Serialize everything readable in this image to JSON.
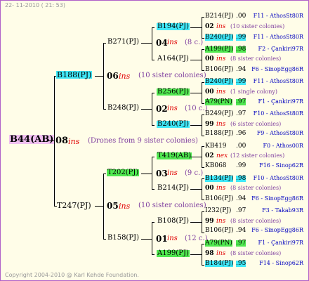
{
  "header_date": "22- 11-2010 ( 21: 53)",
  "footer": "Copyright 2004-2010 @ Karl Kehde Foundation.",
  "root": {
    "label": "B44(AB)"
  },
  "gen1": {
    "num": "08",
    "ins": "ins",
    "note": "(Drones from 9 sister colonies)"
  },
  "g1_top": {
    "label": "B188(PJ)",
    "num": "06",
    "ins": "ins",
    "note": "(10 sister colonies)"
  },
  "g1_bottom": {
    "label": "T247(PJ)",
    "num": "05",
    "ins": "ins",
    "note": "(10 sister colonies)"
  },
  "g2": [
    {
      "label": "B271(PJ)",
      "num": "04",
      "ins": "ins",
      "note": "(8 c.)"
    },
    {
      "label": "B248(PJ)",
      "num": "02",
      "ins": "ins",
      "note": "(10 c.)"
    },
    {
      "label": "T202(PJ)",
      "num": "03",
      "ins": "ins",
      "note": "(9 c.)"
    },
    {
      "label": "B158(PJ)",
      "num": "01",
      "ins": "ins",
      "note": "(12 c.)"
    }
  ],
  "g3": [
    {
      "label": "B194(PJ)"
    },
    {
      "label": "A164(PJ)"
    },
    {
      "label": "B256(PJ)"
    },
    {
      "label": "B240(PJ)"
    },
    {
      "label": "T419(AB)"
    },
    {
      "label": "B214(PJ)"
    },
    {
      "label": "B108(PJ)"
    },
    {
      "label": "A199(PJ)"
    }
  ],
  "g4": [
    {
      "id": "B214(PJ)",
      "val": ".00",
      "src": "F11 - AthosSt80R"
    },
    {
      "num": "02",
      "ins": "ins",
      "note": "(10 sister colonies)"
    },
    {
      "id": "B240(PJ)",
      "val": ".99",
      "src": "F11 - AthosSt80R"
    },
    {
      "id": "A199(PJ)",
      "val": ".98",
      "src": "F2 - Çankiri97R"
    },
    {
      "num": "00",
      "ins": "ins",
      "note": "(8 sister colonies)"
    },
    {
      "id": "B106(PJ)",
      "val": ".94",
      "src": "F6 - SinopEgg86R"
    },
    {
      "id": "B240(PJ)",
      "val": ".99",
      "src": "F11 - AthosSt80R"
    },
    {
      "num": "00",
      "ins": "ins",
      "note": "(1 single colony)"
    },
    {
      "id": "A79(PN)",
      "val": ".97",
      "src": "F1 - Çankiri97R"
    },
    {
      "id": "B249(PJ)",
      "val": ".97",
      "src": "F10 - AthosSt80R"
    },
    {
      "num": "99",
      "ins": "ins",
      "note": "(6 sister colonies)"
    },
    {
      "id": "B188(PJ)",
      "val": ".96",
      "src": "F9 - AthosSt80R"
    },
    {
      "id": "KB419",
      "val": ".00",
      "src": "F0 - Athos00R"
    },
    {
      "num": "02",
      "ins": "nex",
      "note": "(12 sister colonies)"
    },
    {
      "id": "KB068",
      "val": ".99",
      "src": "F16 - Sinop62R"
    },
    {
      "id": "B134(PJ)",
      "val": ".98",
      "src": "F10 - AthosSt80R"
    },
    {
      "num": "00",
      "ins": "ins",
      "note": "(8 sister colonies)"
    },
    {
      "id": "B106(PJ)",
      "val": ".94",
      "src": "F6 - SinopEgg86R"
    },
    {
      "id": "I232(PJ)",
      "val": ".97",
      "src": "F3 - Takab93R"
    },
    {
      "num": "99",
      "ins": "ins",
      "note": "(8 sister colonies)"
    },
    {
      "id": "B106(PJ)",
      "val": ".94",
      "src": "F6 - SinopEgg86R"
    },
    {
      "id": "A79(PN)",
      "val": ".97",
      "src": "F1 - Çankiri97R"
    },
    {
      "num": "98",
      "ins": "ins",
      "note": "(8 sister colonies)"
    },
    {
      "id": "B184(PJ)",
      "val": ".95",
      "src": "F14 - Sinop62R"
    }
  ]
}
